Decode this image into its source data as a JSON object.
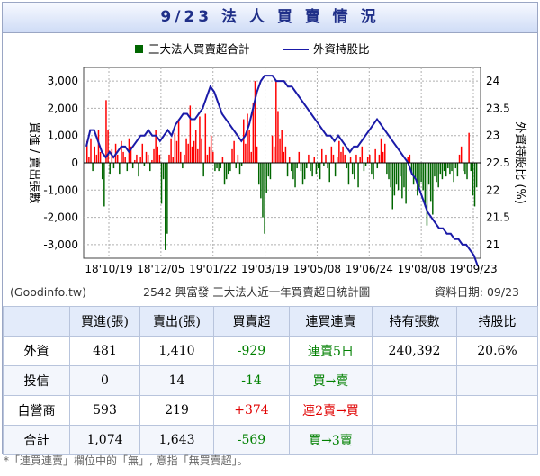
{
  "title": "9/23 法 人 買 賣 情 況",
  "chart": {
    "legend_bar": "三大法人買賣超合計",
    "legend_line": "外資持股比",
    "ylabel_left": "買進 / 賣出張數",
    "ylabel_right": "外資持股比 (%)",
    "footer_left": "(Goodinfo.tw)",
    "footer_center": "2542 興富發 三大法人近一年買賣超日統計圖",
    "footer_right": "資料日期: 09/23",
    "colors": {
      "positive": "#ff0000",
      "negative": "#006600",
      "line": "#1a1aa8"
    }
  },
  "chart_data": {
    "type": "bar+line",
    "x_ticks": [
      "18'10/19",
      "18'12/05",
      "19'01/22",
      "19'03/19",
      "19'05/08",
      "19'06/24",
      "19'08/08",
      "19'09/23"
    ],
    "y_left_ticks": [
      "3,000",
      "2,000",
      "1,000",
      "0",
      "-1,000",
      "-2,000",
      "-3,000"
    ],
    "y_left_values": [
      3000,
      2000,
      1000,
      0,
      -1000,
      -2000,
      -3000
    ],
    "y_right_ticks": [
      "24",
      "23.5",
      "23",
      "22.5",
      "22",
      "21.5",
      "21"
    ],
    "y_right_values": [
      24,
      23.5,
      23,
      22.5,
      22,
      21.5,
      21
    ],
    "ylim_left": [
      -3500,
      3500
    ],
    "ylim_right": [
      20.75,
      24.25
    ],
    "grid": true,
    "legend": "top",
    "series": [
      {
        "name": "三大法人買賣超合計",
        "kind": "bar",
        "values": [
          800,
          200,
          900,
          -300,
          600,
          300,
          1200,
          400,
          -600,
          -1600,
          2300,
          1200,
          -400,
          500,
          -200,
          700,
          300,
          -400,
          800,
          400,
          200,
          -300,
          900,
          600,
          -200,
          100,
          300,
          -500,
          200,
          700,
          -100,
          400,
          300,
          -300,
          100,
          500,
          1200,
          600,
          300,
          -1500,
          -600,
          -3200,
          -2600,
          300,
          900,
          200,
          1100,
          800,
          1600,
          400,
          -200,
          300,
          900,
          700,
          2100,
          600,
          800,
          1200,
          500,
          1700,
          900,
          -500,
          1800,
          300,
          600,
          1000,
          400,
          -300,
          -200,
          -300,
          -200,
          200,
          -800,
          -600,
          -400,
          -300,
          500,
          800,
          -200,
          300,
          -400,
          -100,
          1600,
          700,
          1800,
          1200,
          400,
          2200,
          3000,
          600,
          -800,
          -1300,
          -2000,
          -2600,
          -1100,
          -500,
          -600,
          1000,
          600,
          3000,
          1900,
          900,
          1200,
          400,
          600,
          -500,
          200,
          -300,
          -600,
          -900,
          -200,
          400,
          -300,
          -800,
          -600,
          -200,
          300,
          -300,
          -500,
          200,
          -400,
          -200,
          -600,
          500,
          -100,
          300,
          -200,
          -700,
          600,
          300,
          -500,
          200,
          800,
          400,
          600,
          300,
          -200,
          -800,
          200,
          -400,
          -600,
          300,
          -900,
          200,
          600,
          -300,
          -100,
          200,
          300,
          -400,
          -600,
          500,
          -200,
          300,
          900,
          400,
          700,
          -400,
          -600,
          -900,
          -1700,
          -1200,
          -800,
          -1000,
          -500,
          -1300,
          -900,
          -1500,
          200,
          300,
          -400,
          -800,
          -600,
          -1200,
          -900,
          -700,
          -1000,
          -1600,
          -2300,
          -800,
          -1400,
          -1900,
          -500,
          -700,
          -900,
          -400,
          -600,
          -300,
          -500,
          -200,
          -400,
          -300,
          -700,
          -200,
          -500,
          300,
          600,
          -300,
          -400,
          -600,
          1100,
          -300,
          -1200,
          -1600,
          -900
        ]
      },
      {
        "name": "外資持股比",
        "kind": "line",
        "values": [
          22.8,
          23.1,
          23.1,
          22.9,
          22.7,
          22.6,
          22.7,
          22.6,
          22.7,
          22.8,
          22.8,
          22.7,
          22.8,
          22.9,
          23.0,
          23.0,
          23.1,
          23.0,
          23.0,
          22.9,
          23.0,
          23.1,
          23.0,
          23.2,
          23.3,
          23.4,
          23.4,
          23.3,
          23.3,
          23.4,
          23.5,
          23.7,
          23.9,
          23.8,
          23.6,
          23.4,
          23.3,
          23.2,
          23.1,
          23.0,
          22.9,
          23.0,
          23.2,
          23.5,
          23.8,
          24.0,
          24.1,
          24.1,
          24.1,
          24.0,
          24.0,
          24.0,
          23.9,
          23.9,
          23.8,
          23.7,
          23.6,
          23.5,
          23.4,
          23.3,
          23.2,
          23.1,
          23.0,
          23.0,
          22.9,
          23.0,
          22.9,
          22.8,
          22.7,
          22.8,
          22.8,
          22.9,
          23.0,
          23.1,
          23.2,
          23.3,
          23.2,
          23.1,
          23.0,
          22.9,
          22.8,
          22.7,
          22.6,
          22.5,
          22.3,
          22.2,
          22.0,
          21.8,
          21.6,
          21.5,
          21.4,
          21.3,
          21.3,
          21.2,
          21.2,
          21.1,
          21.1,
          21.0,
          21.0,
          20.9,
          20.8,
          20.6
        ]
      }
    ]
  },
  "table": {
    "headers": [
      "",
      "買進(張)",
      "賣出(張)",
      "買賣超",
      "連買連賣",
      "持有張數",
      "持股比"
    ],
    "rows": [
      {
        "label": "外資",
        "buy": "481",
        "sell": "1,410",
        "net": "-929",
        "streak": "連賣5日",
        "holdings": "240,392",
        "ratio": "20.6%"
      },
      {
        "label": "投信",
        "buy": "0",
        "sell": "14",
        "net": "-14",
        "streak": "買→賣",
        "holdings": "",
        "ratio": ""
      },
      {
        "label": "自營商",
        "buy": "593",
        "sell": "219",
        "net": "+374",
        "streak": "連2賣→買",
        "holdings": "",
        "ratio": ""
      },
      {
        "label": "合計",
        "buy": "1,074",
        "sell": "1,643",
        "net": "-569",
        "streak": "買→3賣",
        "holdings": "",
        "ratio": ""
      }
    ]
  },
  "footnote": "*「連買連賣」欄位中的「無」, 意指「無買賣超」。"
}
